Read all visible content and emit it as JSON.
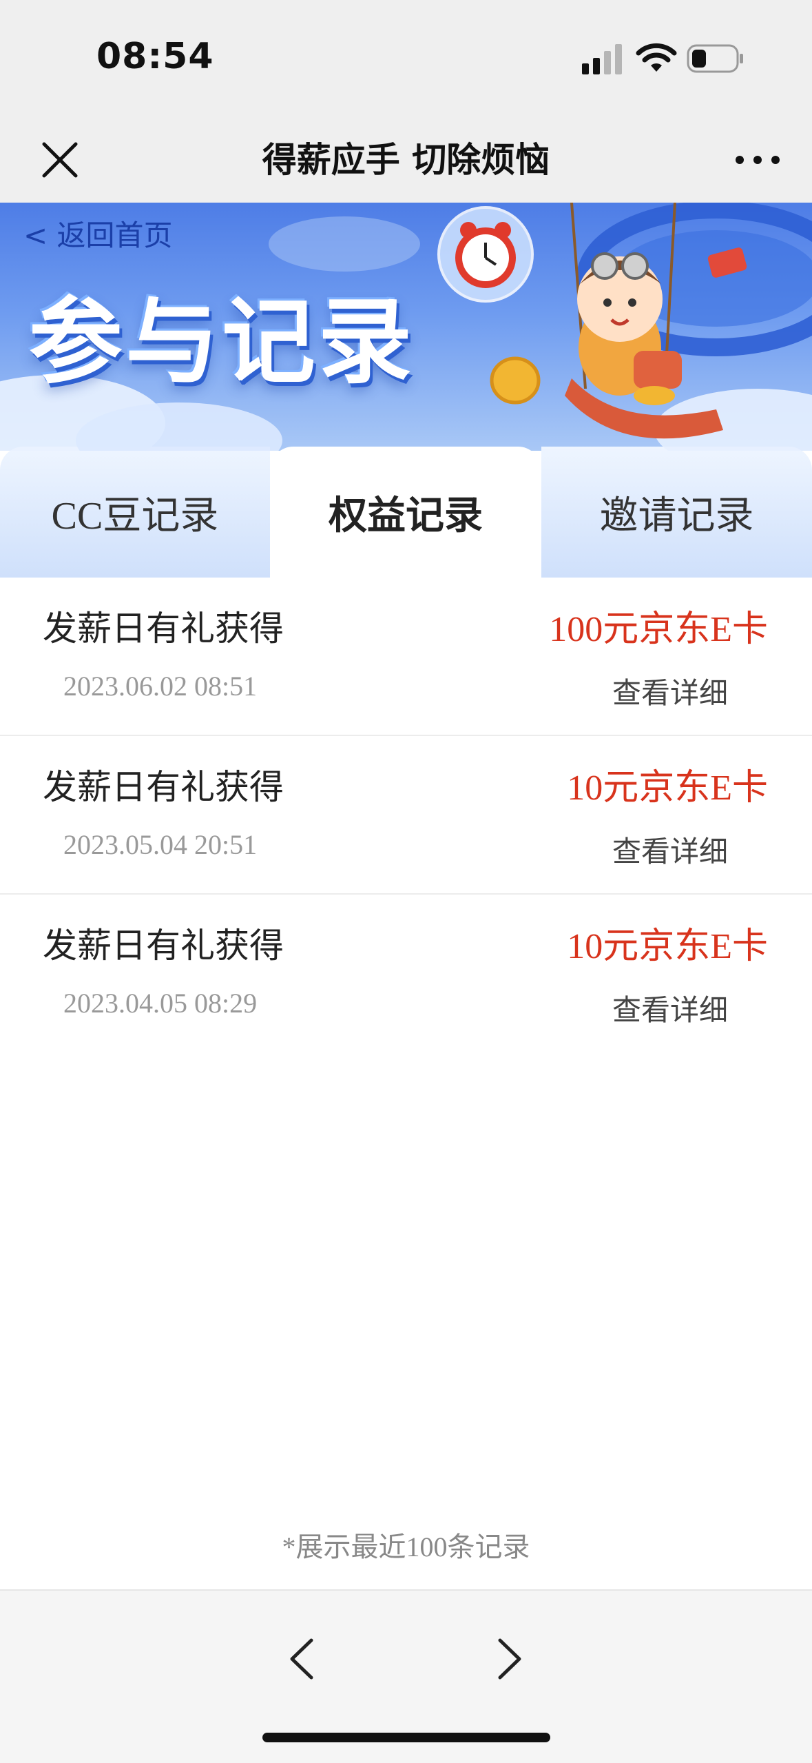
{
  "status_bar": {
    "time": "08:54",
    "icons": [
      "signal-icon",
      "wifi-icon",
      "battery-icon"
    ]
  },
  "nav_bar": {
    "title": "得薪应手 切除烦恼",
    "close_icon": "close-icon",
    "more_icon": "more-icon"
  },
  "banner": {
    "back_link": "< 返回首页",
    "title": "参与记录"
  },
  "tabs": [
    {
      "label": "CC豆记录",
      "active": false
    },
    {
      "label": "权益记录",
      "active": true
    },
    {
      "label": "邀请记录",
      "active": false
    }
  ],
  "records": [
    {
      "title": "发薪日有礼获得",
      "date": "2023.06.02 08:51",
      "reward": "100元京东E卡",
      "detail": "查看详细"
    },
    {
      "title": "发薪日有礼获得",
      "date": "2023.05.04 20:51",
      "reward": "10元京东E卡",
      "detail": "查看详细"
    },
    {
      "title": "发薪日有礼获得",
      "date": "2023.04.05 08:29",
      "reward": "10元京东E卡",
      "detail": "查看详细"
    }
  ],
  "footer_note": "*展示最近100条记录",
  "toolbar": {
    "back_icon": "chevron-left-icon",
    "forward_icon": "chevron-right-icon"
  },
  "colors": {
    "reward": "#d8331c",
    "banner_blue": "#4e7de6",
    "tab_inactive": "#cfe0fb"
  }
}
